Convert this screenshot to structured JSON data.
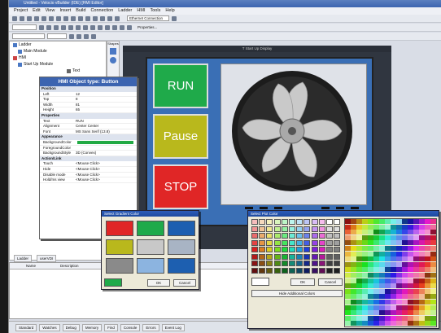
{
  "window": {
    "title": "Untitled - Velocio vBuilder (IDE) [HMI Editor]"
  },
  "menu": [
    "Project",
    "Edit",
    "View",
    "Insert",
    "Build",
    "Connection",
    "Ladder",
    "HMI",
    "Tools",
    "Help"
  ],
  "toolbar": {
    "connection_combo": "Ethernet Connection",
    "properties_label": "Properties..."
  },
  "project_tree": {
    "items": [
      "Ladder",
      "Main Module",
      "Start Up Module",
      "HMI"
    ],
    "text_label": "Text"
  },
  "shapes_pane": {
    "title": "Shapes"
  },
  "properties_dialog": {
    "title": "HMI Object type: Button",
    "rows": [
      {
        "type": "section",
        "label": "Position"
      },
      {
        "type": "row",
        "key": "Left",
        "value": "12"
      },
      {
        "type": "row",
        "key": "Top",
        "value": "8"
      },
      {
        "type": "row",
        "key": "Width",
        "value": "81"
      },
      {
        "type": "row",
        "key": "Height",
        "value": "65"
      },
      {
        "type": "section",
        "label": "Properties"
      },
      {
        "type": "row",
        "key": "Text",
        "value": "RUN"
      },
      {
        "type": "row",
        "key": "Alignment",
        "value": "Center Center"
      },
      {
        "type": "row",
        "key": "Font",
        "value": "MS Sans Serif (13.8)"
      },
      {
        "type": "section",
        "label": "Appearance"
      },
      {
        "type": "row",
        "key": "BackgroundColor",
        "value": "",
        "swatch": "#22aa44"
      },
      {
        "type": "row",
        "key": "ForegroundColor",
        "value": ""
      },
      {
        "type": "row",
        "key": "BackgroundStyle",
        "value": "3D (Convex)"
      },
      {
        "type": "section",
        "label": "Action/Link"
      },
      {
        "type": "row",
        "key": "Touch",
        "value": "<Mouse Click>"
      },
      {
        "type": "row",
        "key": "Hide",
        "value": "<Mouse Click>"
      },
      {
        "type": "row",
        "key": "Disable mode",
        "value": "<Mouse Click>"
      },
      {
        "type": "row",
        "key": "Hold/ms view",
        "value": "<Mouse Click>"
      }
    ]
  },
  "hmi_screen": {
    "title": "T Start Up Display",
    "buttons": [
      {
        "label": "RUN",
        "bg": "#1faa4a",
        "fg": "#ffffff"
      },
      {
        "label": "Pause",
        "bg": "#b9b81c",
        "fg": "#ffffff"
      },
      {
        "label": "STOP",
        "bg": "#e02626",
        "fg": "#ffffff"
      }
    ],
    "fan_icon": "fan-icon"
  },
  "gradient_dialog": {
    "title": "Select Gradient Color",
    "swatches": [
      "#e02626",
      "#1faa4a",
      "#1d5fb0",
      "#b9b81c",
      "#c8c8c8",
      "#a8b4c4",
      "#8a8a8a",
      "#8cb4e0",
      "#1d5fb0"
    ],
    "selected_swatch": "#1faa4a",
    "ok": "OK",
    "cancel": "Cancel"
  },
  "color_dialog": {
    "title": "Select Plot Color",
    "ok": "OK",
    "cancel": "Cancel",
    "hide_label": "Hide Additional Colors"
  },
  "side_tabs": {
    "ladder": "Ladder",
    "user": "userVDI"
  },
  "output_pane": {
    "headers": [
      "Name",
      "Description"
    ]
  },
  "status_tabs": [
    "Standard",
    "Watches",
    "Debug",
    "Memory",
    "Find",
    "Console",
    "Errors",
    "Event Log"
  ]
}
